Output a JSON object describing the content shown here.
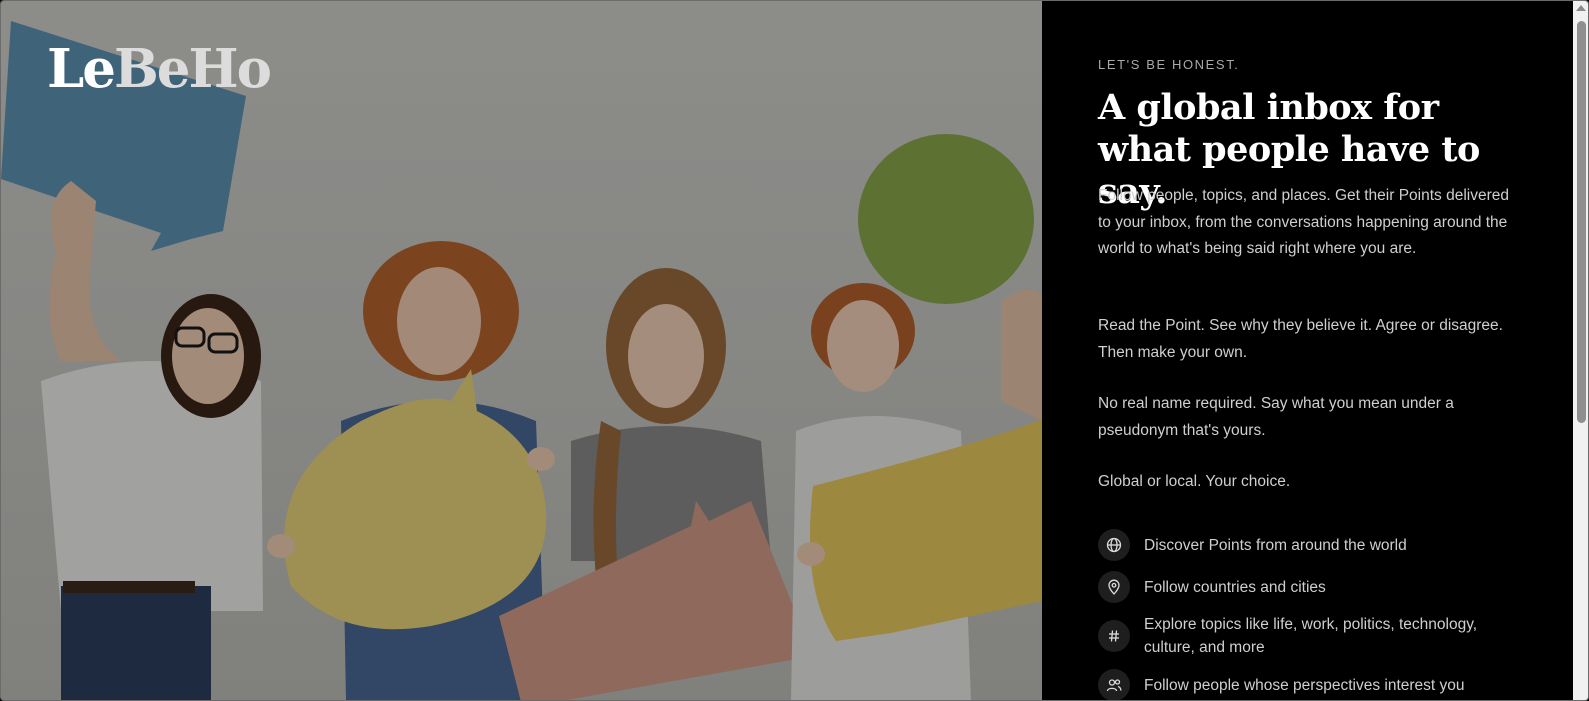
{
  "brand": {
    "logo_part1": "Le",
    "logo_part2": "BeHo"
  },
  "panel": {
    "eyebrow": "LET'S BE HONEST.",
    "headline": "A global inbox for what people have to say.",
    "paragraphs": [
      "Follow people, topics, and places. Get their Points delivered to your inbox, from the conversations happening around the world to what's being said right where you are.",
      "Read the Point. See why they believe it. Agree or disagree. Then make your own.",
      "No real name required. Say what you mean under a pseudonym that's yours.",
      "Global or local. Your choice."
    ],
    "features": [
      {
        "icon": "globe-icon",
        "text": "Discover Points from around the world"
      },
      {
        "icon": "map-pin-icon",
        "text": "Follow countries and cities"
      },
      {
        "icon": "hash-icon",
        "text": "Explore topics like life, work, politics, technology, culture, and more"
      },
      {
        "icon": "users-icon",
        "text": "Follow people whose perspectives interest you"
      }
    ]
  },
  "colors": {
    "panel_bg": "#000000",
    "headline": "#ffffff",
    "body_text": "#cfcfcf",
    "icon_bg": "#1e1e1e"
  }
}
